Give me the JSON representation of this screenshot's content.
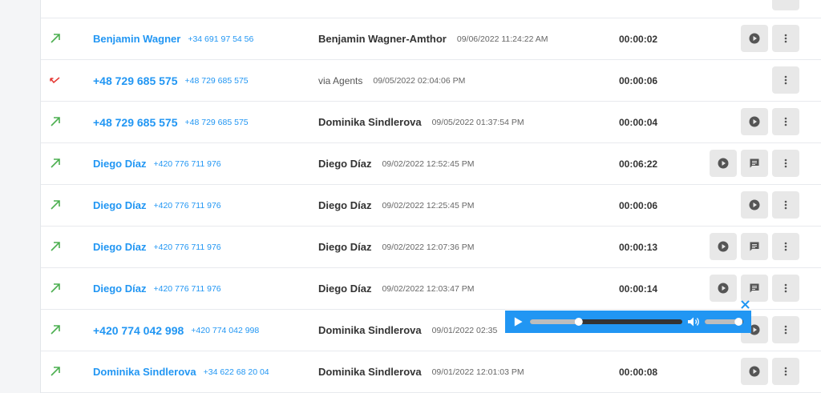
{
  "colors": {
    "link": "#2196f3",
    "outgoing": "#4caf50",
    "missed": "#e53935",
    "button_bg": "#e8e8e8",
    "player_bg": "#2196f3"
  },
  "icons": {
    "outgoing": "arrow-up-right-icon",
    "missed": "missed-call-icon",
    "play": "play-circle-icon",
    "transcript": "comment-icon",
    "more": "more-vertical-icon"
  },
  "rows": [
    {
      "direction": "outgoing",
      "caller": "Benjamin Wagner",
      "caller_number": "+34 691 97 54 56",
      "agent": "Benjamin Wagner-Amthor",
      "date": "09/06/2022 11:24:22 AM",
      "duration": "00:00:02",
      "buttons": [
        "play",
        "more"
      ]
    },
    {
      "direction": "missed",
      "caller": "+48 729 685 575",
      "caller_number": "+48 729 685 575",
      "agent": "via Agents",
      "date": "09/05/2022 02:04:06 PM",
      "duration": "00:00:06",
      "buttons": [
        "more"
      ]
    },
    {
      "direction": "outgoing",
      "caller": "+48 729 685 575",
      "caller_number": "+48 729 685 575",
      "agent": "Dominika Sindlerova",
      "date": "09/05/2022 01:37:54 PM",
      "duration": "00:00:04",
      "buttons": [
        "play",
        "more"
      ]
    },
    {
      "direction": "outgoing",
      "caller": "Diego Díaz",
      "caller_number": "+420 776 711 976",
      "agent": "Diego Díaz",
      "date": "09/02/2022 12:52:45 PM",
      "duration": "00:06:22",
      "buttons": [
        "play",
        "transcript",
        "more"
      ]
    },
    {
      "direction": "outgoing",
      "caller": "Diego Díaz",
      "caller_number": "+420 776 711 976",
      "agent": "Diego Díaz",
      "date": "09/02/2022 12:25:45 PM",
      "duration": "00:00:06",
      "buttons": [
        "play",
        "more"
      ]
    },
    {
      "direction": "outgoing",
      "caller": "Diego Díaz",
      "caller_number": "+420 776 711 976",
      "agent": "Diego Díaz",
      "date": "09/02/2022 12:07:36 PM",
      "duration": "00:00:13",
      "buttons": [
        "play",
        "transcript",
        "more"
      ]
    },
    {
      "direction": "outgoing",
      "caller": "Diego Díaz",
      "caller_number": "+420 776 711 976",
      "agent": "Diego Díaz",
      "date": "09/02/2022 12:03:47 PM",
      "duration": "00:00:14",
      "buttons": [
        "play",
        "transcript",
        "more"
      ]
    },
    {
      "direction": "outgoing",
      "caller": "+420 774 042 998",
      "caller_number": "+420 774 042 998",
      "agent": "Dominika Sindlerova",
      "date": "09/01/2022 02:35",
      "duration": "",
      "buttons": [
        "play",
        "more"
      ]
    },
    {
      "direction": "outgoing",
      "caller": "Dominika Sindlerova",
      "caller_number": "+34 622 68 20 04",
      "agent": "Dominika Sindlerova",
      "date": "09/01/2022 12:01:03 PM",
      "duration": "00:00:08",
      "buttons": [
        "play",
        "more"
      ]
    }
  ],
  "player": {
    "progress": 0.32,
    "volume": 0.88
  }
}
